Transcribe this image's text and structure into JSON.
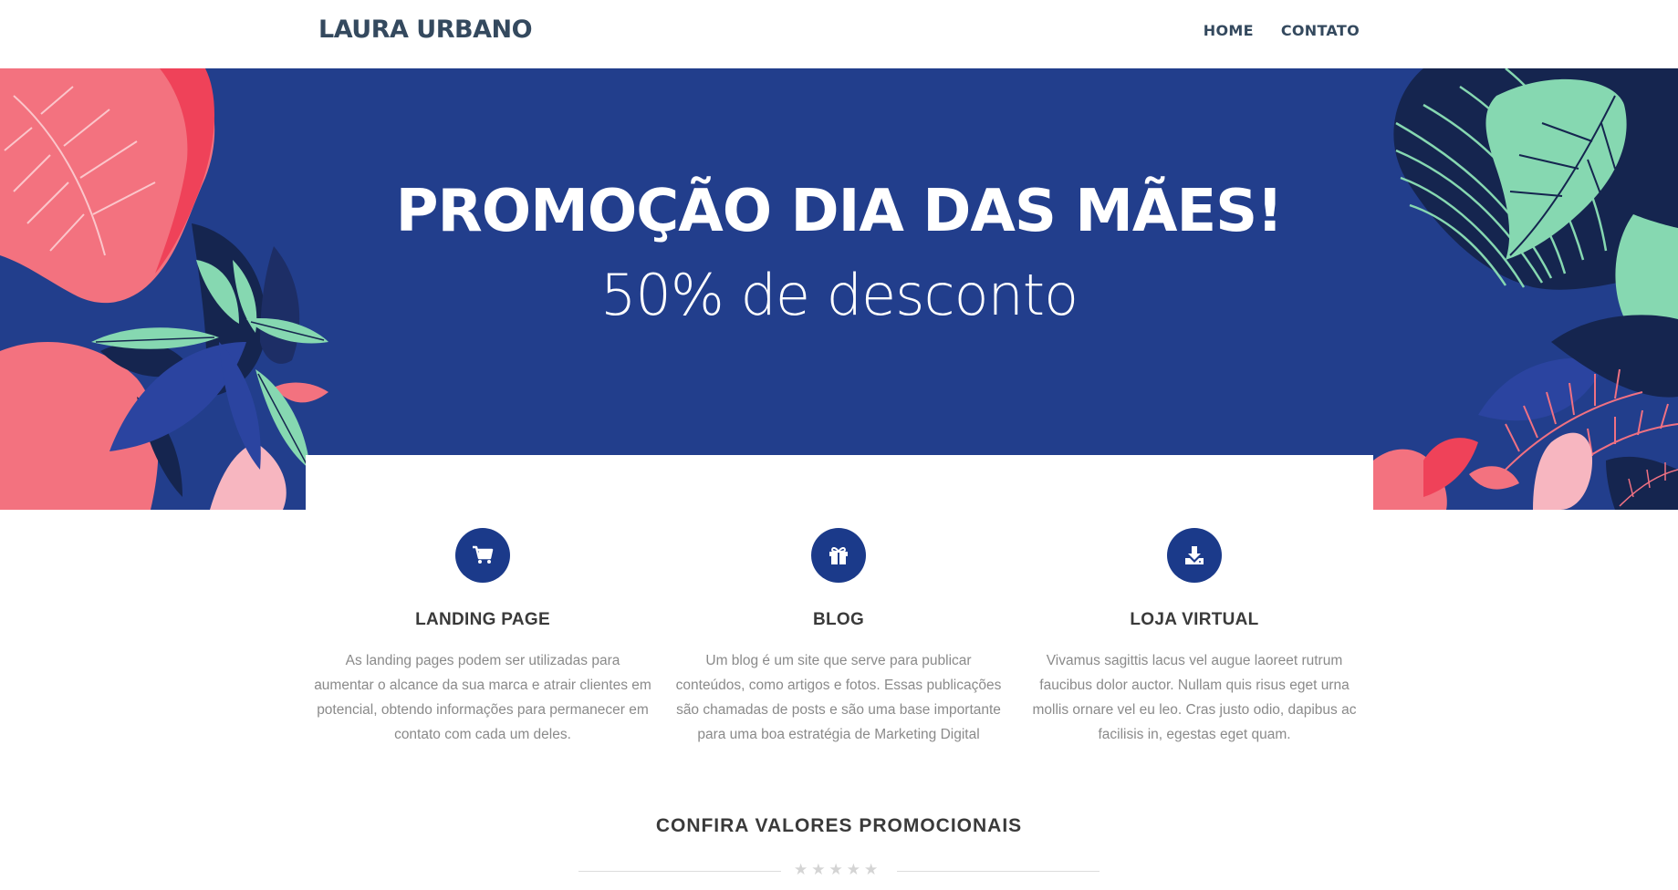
{
  "navbar": {
    "brand": "LAURA URBANO",
    "links": [
      {
        "label": "HOME"
      },
      {
        "label": "CONTATO"
      }
    ]
  },
  "hero": {
    "title": "PROMOÇÃO DIA DAS MÃES!",
    "subtitle": "50% de desconto",
    "background_color": "#223e8c"
  },
  "features": [
    {
      "icon": "cart-icon",
      "title": "LANDING PAGE",
      "text": "As landing pages podem ser utilizadas para aumentar o alcance da sua marca e atrair clientes em potencial, obtendo informações para permanecer em contato com cada um deles."
    },
    {
      "icon": "gift-icon",
      "title": "BLOG",
      "text": "Um blog é um site que serve para publicar conteúdos, como artigos e fotos. Essas publicações são chamadas de posts e são uma base importante para uma boa estratégia de Marketing Digital"
    },
    {
      "icon": "download-icon",
      "title": "LOJA VIRTUAL",
      "text": "Vivamus sagittis lacus vel augue laoreet rutrum faucibus dolor auctor. Nullam quis risus eget urna mollis ornare vel eu leo. Cras justo odio, dapibus ac facilisis in, egestas eget quam."
    }
  ],
  "promo_section": {
    "title": "CONFIRA VALORES PROMOCIONAIS",
    "stars": [
      "★",
      "★",
      "★",
      "★",
      "★"
    ]
  },
  "colors": {
    "accent": "#1b3a8a",
    "hero_bg": "#223e8c",
    "pink": "#f07182",
    "mint": "#86d8b1",
    "navy": "#15254f"
  }
}
